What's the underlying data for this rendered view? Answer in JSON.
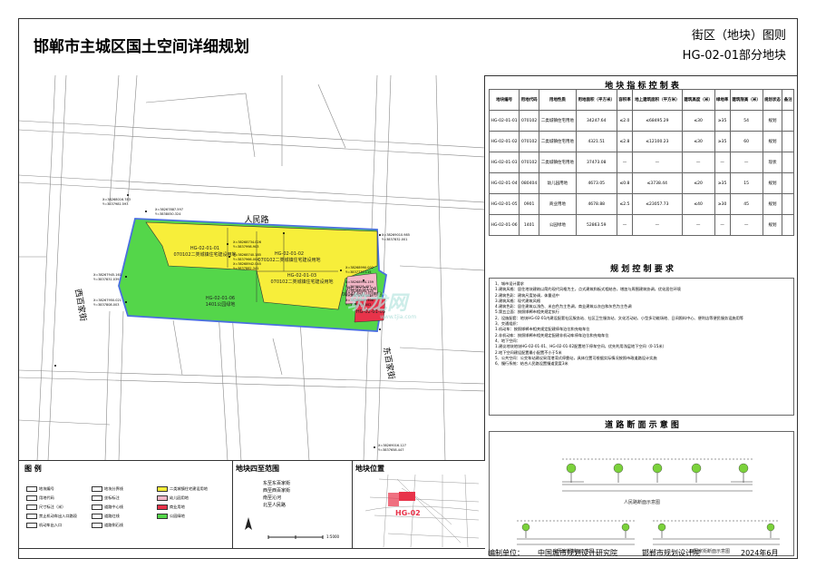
{
  "header": {
    "title": "邯郸市主城区国土空间详细规划",
    "subtitle": "街区（地块）图则",
    "code": "HG-02-01部分地块"
  },
  "map": {
    "road_north": "人民路",
    "road_west": "西百家街",
    "road_east": "东百家街",
    "parcels": [
      {
        "id": "HG-02-01-01",
        "use": "070102二类城镇住宅建设用地"
      },
      {
        "id": "HG-02-01-02",
        "use": "070102二类城镇住宅建设用地"
      },
      {
        "id": "HG-02-01-03",
        "use": "070102二类城镇住宅建设用地"
      },
      {
        "id": "HG-02-01-04",
        "use": "080404幼儿园用地"
      },
      {
        "id": "HG-02-01-05",
        "use": ""
      },
      {
        "id": "HG-02-01-06",
        "use": "1401公园绿地"
      }
    ],
    "coords": [
      "X=38268016.783",
      "Y=3837981.593",
      "X=38267887.597",
      "Y=3838050.324",
      "X=38268734.026",
      "Y=3837998.903",
      "X=38268740.185",
      "Y=3837966.004",
      "X=38268942.045",
      "Y=3837882.341",
      "X=38268990.002",
      "Y=3837770.115",
      "X=38268994.159",
      "Y=3838028.457",
      "X=38269010.985",
      "Y=3837832.001",
      "X=38268994.775",
      "Y=3837845.101",
      "X=38268949.700",
      "Y=3837914.002",
      "X=38267945.161",
      "Y=3837831.039",
      "X=38267950.021",
      "Y=3837808.003",
      "X=38269016.127",
      "Y=3837658.447"
    ]
  },
  "index_table": {
    "title": "地 块 指 标 控 制 表",
    "headers": [
      "地块编号",
      "用地代码",
      "用地性质",
      "用地面积（平方米）",
      "容积率",
      "地上建筑面积（平方米）",
      "建筑高度（米）",
      "绿地率",
      "建筑限高（米）",
      "规划状态",
      "备注"
    ],
    "rows": [
      [
        "HG-02-01-01",
        "070102",
        "二类城镇住宅用地",
        "34247.64",
        "≤2.0",
        "≤68495.29",
        "≤30",
        "≥35",
        "54",
        "规划",
        ""
      ],
      [
        "HG-02-01-02",
        "070102",
        "二类城镇住宅用地",
        "4321.51",
        "≤2.8",
        "≤12100.23",
        "≤30",
        "≥35",
        "60",
        "规划",
        ""
      ],
      [
        "HG-02-01-03",
        "070102",
        "二类城镇住宅用地",
        "37473.08",
        "—",
        "—",
        "—",
        "—",
        "—",
        "现状",
        ""
      ],
      [
        "HG-02-01-04",
        "080404",
        "幼儿园用地",
        "4673.05",
        "≤0.8",
        "≤3738.44",
        "≤20",
        "≥35",
        "15",
        "规划",
        ""
      ],
      [
        "HG-02-01-05",
        "0901",
        "商业用地",
        "4678.88",
        "≤2.5",
        "≤23057.73",
        "≤40",
        "≥30",
        "45",
        "规划",
        ""
      ],
      [
        "HG-02-01-06",
        "1401",
        "公园绿地",
        "52863.59",
        "—",
        "—",
        "—",
        "—",
        "—",
        "规划",
        ""
      ]
    ]
  },
  "requirements": {
    "title": "规 划 控 制 要 求",
    "lines": [
      "1、城市设计要求",
      "  1.建筑风格：居住地块建筑以简约现代风格为主，点式建筑和板式相结合，增加与周围建筑协调，优化居住环境",
      "  2.建筑色彩：建筑尺度协调，体量适中",
      "  3.建筑风格：现代建筑风格",
      "  4.建筑色彩：居住建筑以浅色、米白色为主色调，商业建筑以灰白和灰色为主色调",
      "  5.第五立面：按照邯郸市相关规定执行",
      "2、设施配套：地块HG-02-01内建设配套社区服务站、社区卫生服务站、文化活动站、小型多功能场地、日间照料中心、便利店等便民服务设施用等",
      "3、交通组织：",
      "  1.机动车：按照邯郸市相关规定配建停车泊位和充电车位",
      "  2.非机动车：按照邯郸市相关规定配建非机动车停车泊位和充电车位",
      "4、地下空间：",
      "  1.建议地块地块HG-02-01-01、HG-02-01-02配置地下停车空间，优先利用浅层地下空间（0-15米）",
      "  2.地下空间建设配置最小配置不小于5米",
      "5、公共空间：公交车站建议采用港湾式停靠站，具体位置可根据实际情况按照市政道路设计实施",
      "6、慢行系统：结合人民路设置慢道宽度3米"
    ]
  },
  "sections": {
    "title": "道 路 断 面 示 意 图",
    "a": "人民路断面示意图",
    "b": "东百家街断面示意图",
    "c": "西百家街断面示意图"
  },
  "legend": {
    "title": "图 例",
    "items": [
      "地块编号",
      "用地代码",
      "尺寸标注（米）",
      "禁止机动车出入口路段",
      "机动车出入口",
      "地块分界线",
      "坐标标注",
      "道路中心线",
      "道路红线",
      "道路侧石线",
      "二类城镇住宅建设用地",
      "幼儿园用地",
      "商业用地",
      "公园绿地"
    ]
  },
  "scope": {
    "title": "地块四至范围",
    "items": [
      "东至东百家街",
      "西至西百家街",
      "南至沁河",
      "北至人民路"
    ],
    "scale": "1:5000"
  },
  "location": {
    "title": "地块位置",
    "label": "HG-02"
  },
  "footer": {
    "org_label": "编制单位：",
    "org1": "中国城市规划设计研究院",
    "org2": "邯郸市规划设计院",
    "date": "2024年6月"
  },
  "watermark": {
    "text": "筑龙网",
    "url": "www.tjia.com"
  },
  "colors": {
    "residential": "#f7ee3a",
    "kindergarten": "#f4b8c8",
    "commercial": "#e8334a",
    "green": "#54d64a",
    "road_edge": "#4a6fe0"
  }
}
